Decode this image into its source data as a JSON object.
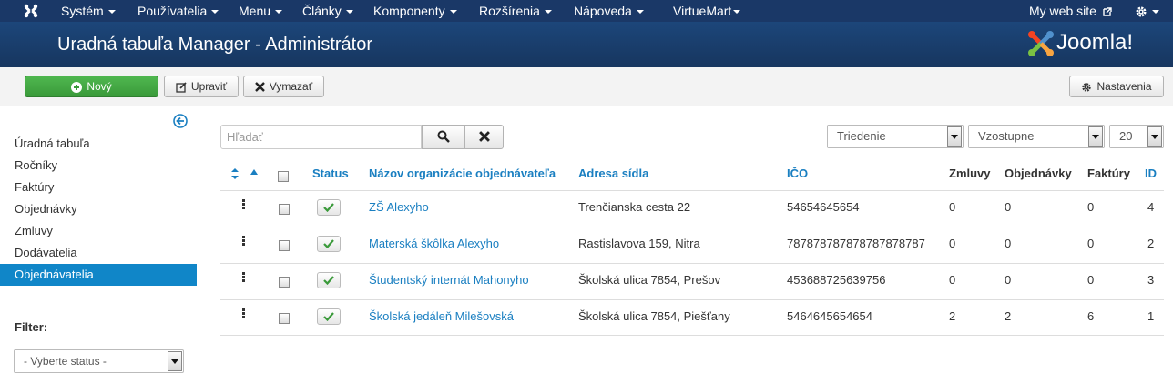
{
  "topnav": {
    "menus": [
      "Systém",
      "Používatelia",
      "Menu",
      "Články",
      "Komponenty",
      "Rozšírenia",
      "Nápoveda",
      "VirtueMart"
    ],
    "site_link": "My web site",
    "settings_icon": "gear-icon"
  },
  "header": {
    "title": "Uradná tabuľa Manager - Administrátor",
    "logo_text": "Joomla!"
  },
  "toolbar": {
    "new_label": "Nový",
    "edit_label": "Upraviť",
    "delete_label": "Vymazať",
    "options_label": "Nastavenia"
  },
  "sidebar": {
    "items": [
      {
        "label": "Úradná tabuľa",
        "active": false
      },
      {
        "label": "Ročníky",
        "active": false
      },
      {
        "label": "Faktúry",
        "active": false
      },
      {
        "label": "Objednávky",
        "active": false
      },
      {
        "label": "Zmluvy",
        "active": false
      },
      {
        "label": "Dodávatelia",
        "active": false
      },
      {
        "label": "Objednávatelia",
        "active": true
      }
    ],
    "filter_label": "Filter:",
    "status_select": "- Vyberte status -"
  },
  "search": {
    "placeholder": "Hľadať"
  },
  "sorting": {
    "order_by": "Triedenie",
    "direction": "Vzostupne",
    "limit": "20"
  },
  "table": {
    "headers": {
      "status": "Status",
      "name": "Názov organizácie objednávateľa",
      "address": "Adresa sídla",
      "ico": "IČO",
      "contracts": "Zmluvy",
      "orders": "Objednávky",
      "invoices": "Faktúry",
      "id": "ID"
    },
    "rows": [
      {
        "name": "ZŠ Alexyho",
        "address": "Trenčianska cesta 22",
        "ico": "54654645654",
        "contracts": "0",
        "orders": "0",
        "invoices": "0",
        "id": "4"
      },
      {
        "name": "Materská škôlka Alexyho",
        "address": "Rastislavova 159, Nitra",
        "ico": "787878787878787878787",
        "contracts": "0",
        "orders": "0",
        "invoices": "0",
        "id": "2"
      },
      {
        "name": "Študentský internát Mahonyho",
        "address": "Školská ulica 7854, Prešov",
        "ico": "453688725639756",
        "contracts": "0",
        "orders": "0",
        "invoices": "0",
        "id": "3"
      },
      {
        "name": "Školská jedáleň Milešovská",
        "address": "Školská ulica 7854, Piešťany",
        "ico": "5464645654654",
        "contracts": "2",
        "orders": "2",
        "invoices": "6",
        "id": "1"
      }
    ]
  },
  "colors": {
    "topnav": "#1a3867",
    "header": "#1b4474",
    "link": "#1a7fc1",
    "active": "#1086c8",
    "new_button": "#46a546"
  }
}
